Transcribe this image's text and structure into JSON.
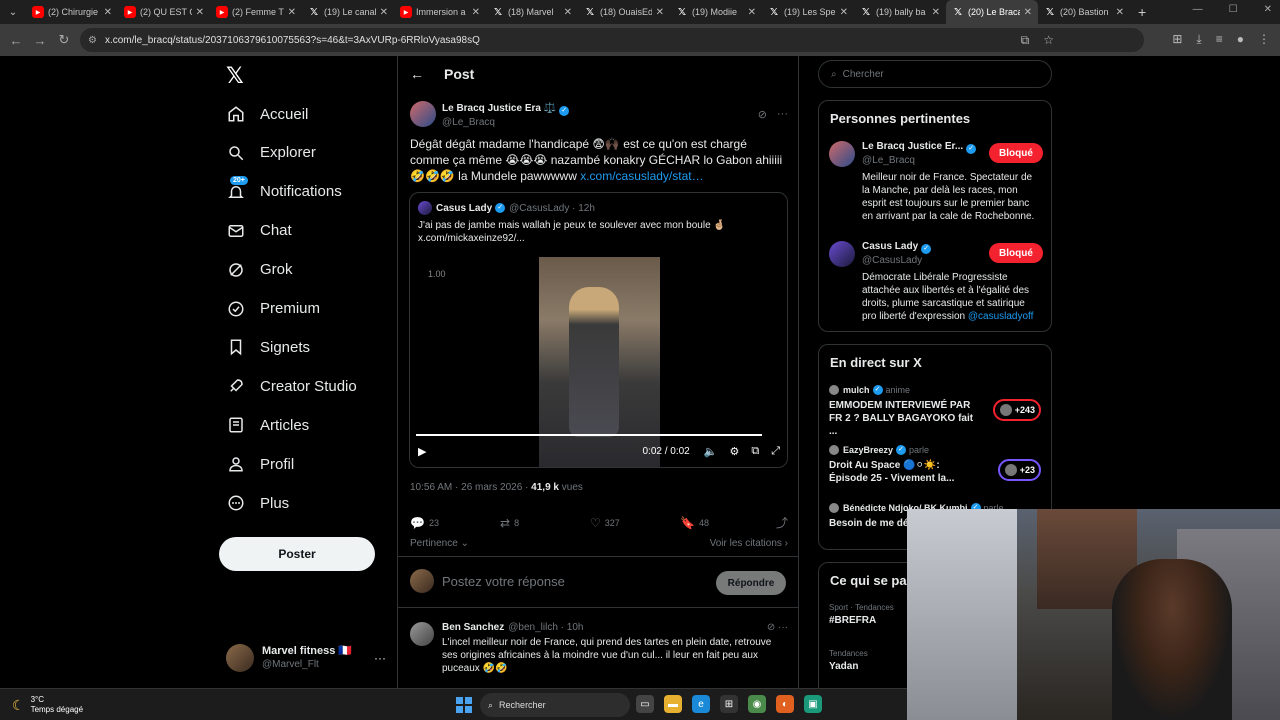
{
  "browser": {
    "tabs": [
      {
        "label": "(2) Chirurgie",
        "icon": "youtube-icon",
        "active": false
      },
      {
        "label": "(2) QU EST C",
        "icon": "youtube-icon",
        "active": false
      },
      {
        "label": "(2) Femme Tr",
        "icon": "youtube-icon",
        "active": false
      },
      {
        "label": "(19) Le canal",
        "icon": "x-icon",
        "active": false
      },
      {
        "label": "Immersion a",
        "icon": "youtube-icon",
        "active": false
      },
      {
        "label": "(18) Marvel",
        "icon": "x-icon",
        "active": false
      },
      {
        "label": "(18) OuaisEd",
        "icon": "x-icon",
        "active": false
      },
      {
        "label": "(19) Modiie",
        "icon": "x-icon",
        "active": false
      },
      {
        "label": "(19) Les Spe",
        "icon": "x-icon",
        "active": false
      },
      {
        "label": "(19) bally ba",
        "icon": "x-icon",
        "active": false
      },
      {
        "label": "(20) Le Braca",
        "icon": "x-icon",
        "active": true
      },
      {
        "label": "(20) Bastion",
        "icon": "x-icon",
        "active": false
      }
    ],
    "url": "x.com/le_bracq/status/2037106379610075563?s=46&t=3AxVURp-6RRloVyasa98sQ"
  },
  "nav": {
    "items": [
      {
        "label": "Accueil",
        "icon": "home-icon"
      },
      {
        "label": "Explorer",
        "icon": "search-icon"
      },
      {
        "label": "Notifications",
        "icon": "bell-icon",
        "badge": "20+"
      },
      {
        "label": "Chat",
        "icon": "mail-icon"
      },
      {
        "label": "Grok",
        "icon": "grok-icon"
      },
      {
        "label": "Premium",
        "icon": "premium-icon"
      },
      {
        "label": "Signets",
        "icon": "bookmark-icon"
      },
      {
        "label": "Creator Studio",
        "icon": "rocket-icon"
      },
      {
        "label": "Articles",
        "icon": "article-icon"
      },
      {
        "label": "Profil",
        "icon": "user-icon"
      },
      {
        "label": "Plus",
        "icon": "more-circle-icon"
      }
    ],
    "post_button": "Poster",
    "me": {
      "name": "Marvel fitness 🇫🇷",
      "handle": "@Marvel_Flt"
    }
  },
  "main": {
    "title": "Post",
    "tweet": {
      "name": "Le Bracq Justice Era ⚖️",
      "handle": "@Le_Bracq",
      "text": "Dégât dégât madame l'handicapé 😨🙌🏿 est ce qu'on est chargé comme ça même 😭😭😭 nazambé konakry GÉCHAR lo Gabon ahiiiii 🤣🤣🤣 la Mundele pawwwww ",
      "link": "x.com/casuslady/stat…",
      "quote": {
        "name": "Casus Lady",
        "handle": "@CasusLady · 12h",
        "text": "J'ai pas de jambe mais wallah je peux te soulever avec mon boule 🤞🏼 x.com/mickaxeinze92/...",
        "video_speed": "1.00",
        "video_time": "0:02 / 0:02",
        "progress": 1.0
      },
      "timestamp": "10:56 AM · 26 mars 2026 · ",
      "views_count": "41,9 k",
      "views_label": " vues",
      "stats": {
        "replies": "23",
        "reposts": "8",
        "likes": "327",
        "bookmarks": "48"
      },
      "sort_label": "Pertinence ⌄",
      "quotes_link": "Voir les citations ›"
    },
    "reply_placeholder": "Postez votre réponse",
    "reply_button": "Répondre",
    "reply": {
      "name": "Ben Sanchez",
      "meta": "@ben_lilch · 10h",
      "text": "L'incel meilleur noir de France, qui prend des tartes en plein date, retrouve ses origines africaines à la moindre vue d'un cul... il leur en fait peu aux puceaux 🤣🤣"
    }
  },
  "sidebar": {
    "search_placeholder": "Chercher",
    "relevant_title": "Personnes pertinentes",
    "people": [
      {
        "name": "Le Bracq Justice Er...",
        "handle": "@Le_Bracq",
        "bio": "Meilleur noir de France. Spectateur de la Manche, par delà les races, mon esprit est toujours sur le premier banc en arrivant par la cale de Rochebonne.",
        "bio_link": "",
        "button": "Bloqué"
      },
      {
        "name": "Casus Lady",
        "handle": "@CasusLady",
        "bio": "Démocrate Libérale Progressiste attachée aux libertés et à l'égalité des droits, plume sarcastique et satirique pro liberté d'expression ",
        "bio_link": "@casusladyoff",
        "button": "Bloqué"
      }
    ],
    "live_title": "En direct sur X",
    "live": [
      {
        "host": "mulch",
        "action": "anime",
        "title": "EMMODEM INTERVIEWÉ PAR FR 2 ? BALLY BAGAYOKO fait ...",
        "count": "+243"
      },
      {
        "host": "EazyBreezy",
        "action": "parle",
        "title": "Droit Au Space 🔵⚪☀️: Épisode 25 - Vivement la...",
        "count": "+23"
      },
      {
        "host": "Bénédicte Ndjoko/ BK Kumbi",
        "action": "parle",
        "title": "Besoin de me dé..."
      }
    ],
    "trends_title": "Ce qui se pa",
    "trends": [
      {
        "category": "Sport · Tendances",
        "name": "#BREFRA"
      },
      {
        "category": "Tendances",
        "name": "Yadan"
      }
    ]
  },
  "taskbar": {
    "temp": "3°C",
    "weather": "Temps dégagé",
    "search": "Rechercher"
  }
}
